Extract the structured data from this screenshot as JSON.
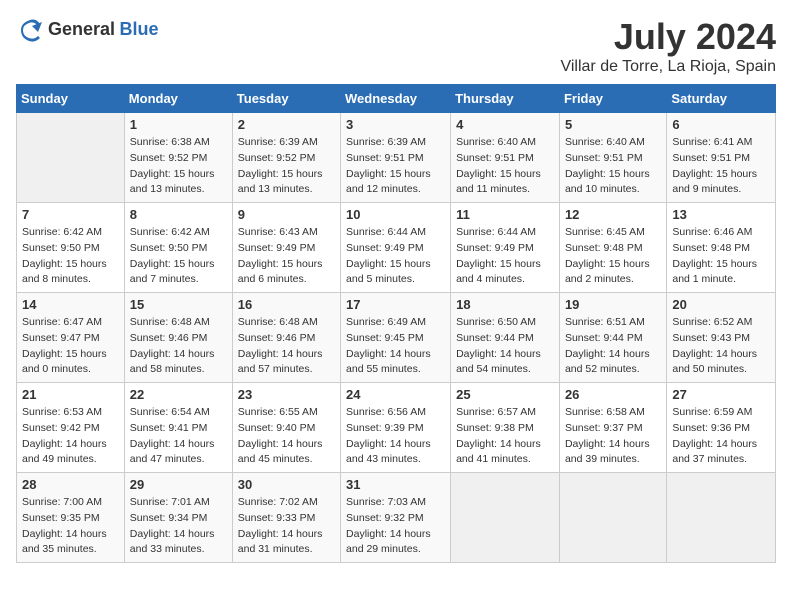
{
  "logo": {
    "general": "General",
    "blue": "Blue"
  },
  "title": "July 2024",
  "location": "Villar de Torre, La Rioja, Spain",
  "days_of_week": [
    "Sunday",
    "Monday",
    "Tuesday",
    "Wednesday",
    "Thursday",
    "Friday",
    "Saturday"
  ],
  "weeks": [
    [
      {
        "day": "",
        "content": ""
      },
      {
        "day": "1",
        "content": "Sunrise: 6:38 AM\nSunset: 9:52 PM\nDaylight: 15 hours\nand 13 minutes."
      },
      {
        "day": "2",
        "content": "Sunrise: 6:39 AM\nSunset: 9:52 PM\nDaylight: 15 hours\nand 13 minutes."
      },
      {
        "day": "3",
        "content": "Sunrise: 6:39 AM\nSunset: 9:51 PM\nDaylight: 15 hours\nand 12 minutes."
      },
      {
        "day": "4",
        "content": "Sunrise: 6:40 AM\nSunset: 9:51 PM\nDaylight: 15 hours\nand 11 minutes."
      },
      {
        "day": "5",
        "content": "Sunrise: 6:40 AM\nSunset: 9:51 PM\nDaylight: 15 hours\nand 10 minutes."
      },
      {
        "day": "6",
        "content": "Sunrise: 6:41 AM\nSunset: 9:51 PM\nDaylight: 15 hours\nand 9 minutes."
      }
    ],
    [
      {
        "day": "7",
        "content": "Sunrise: 6:42 AM\nSunset: 9:50 PM\nDaylight: 15 hours\nand 8 minutes."
      },
      {
        "day": "8",
        "content": "Sunrise: 6:42 AM\nSunset: 9:50 PM\nDaylight: 15 hours\nand 7 minutes."
      },
      {
        "day": "9",
        "content": "Sunrise: 6:43 AM\nSunset: 9:49 PM\nDaylight: 15 hours\nand 6 minutes."
      },
      {
        "day": "10",
        "content": "Sunrise: 6:44 AM\nSunset: 9:49 PM\nDaylight: 15 hours\nand 5 minutes."
      },
      {
        "day": "11",
        "content": "Sunrise: 6:44 AM\nSunset: 9:49 PM\nDaylight: 15 hours\nand 4 minutes."
      },
      {
        "day": "12",
        "content": "Sunrise: 6:45 AM\nSunset: 9:48 PM\nDaylight: 15 hours\nand 2 minutes."
      },
      {
        "day": "13",
        "content": "Sunrise: 6:46 AM\nSunset: 9:48 PM\nDaylight: 15 hours\nand 1 minute."
      }
    ],
    [
      {
        "day": "14",
        "content": "Sunrise: 6:47 AM\nSunset: 9:47 PM\nDaylight: 15 hours\nand 0 minutes."
      },
      {
        "day": "15",
        "content": "Sunrise: 6:48 AM\nSunset: 9:46 PM\nDaylight: 14 hours\nand 58 minutes."
      },
      {
        "day": "16",
        "content": "Sunrise: 6:48 AM\nSunset: 9:46 PM\nDaylight: 14 hours\nand 57 minutes."
      },
      {
        "day": "17",
        "content": "Sunrise: 6:49 AM\nSunset: 9:45 PM\nDaylight: 14 hours\nand 55 minutes."
      },
      {
        "day": "18",
        "content": "Sunrise: 6:50 AM\nSunset: 9:44 PM\nDaylight: 14 hours\nand 54 minutes."
      },
      {
        "day": "19",
        "content": "Sunrise: 6:51 AM\nSunset: 9:44 PM\nDaylight: 14 hours\nand 52 minutes."
      },
      {
        "day": "20",
        "content": "Sunrise: 6:52 AM\nSunset: 9:43 PM\nDaylight: 14 hours\nand 50 minutes."
      }
    ],
    [
      {
        "day": "21",
        "content": "Sunrise: 6:53 AM\nSunset: 9:42 PM\nDaylight: 14 hours\nand 49 minutes."
      },
      {
        "day": "22",
        "content": "Sunrise: 6:54 AM\nSunset: 9:41 PM\nDaylight: 14 hours\nand 47 minutes."
      },
      {
        "day": "23",
        "content": "Sunrise: 6:55 AM\nSunset: 9:40 PM\nDaylight: 14 hours\nand 45 minutes."
      },
      {
        "day": "24",
        "content": "Sunrise: 6:56 AM\nSunset: 9:39 PM\nDaylight: 14 hours\nand 43 minutes."
      },
      {
        "day": "25",
        "content": "Sunrise: 6:57 AM\nSunset: 9:38 PM\nDaylight: 14 hours\nand 41 minutes."
      },
      {
        "day": "26",
        "content": "Sunrise: 6:58 AM\nSunset: 9:37 PM\nDaylight: 14 hours\nand 39 minutes."
      },
      {
        "day": "27",
        "content": "Sunrise: 6:59 AM\nSunset: 9:36 PM\nDaylight: 14 hours\nand 37 minutes."
      }
    ],
    [
      {
        "day": "28",
        "content": "Sunrise: 7:00 AM\nSunset: 9:35 PM\nDaylight: 14 hours\nand 35 minutes."
      },
      {
        "day": "29",
        "content": "Sunrise: 7:01 AM\nSunset: 9:34 PM\nDaylight: 14 hours\nand 33 minutes."
      },
      {
        "day": "30",
        "content": "Sunrise: 7:02 AM\nSunset: 9:33 PM\nDaylight: 14 hours\nand 31 minutes."
      },
      {
        "day": "31",
        "content": "Sunrise: 7:03 AM\nSunset: 9:32 PM\nDaylight: 14 hours\nand 29 minutes."
      },
      {
        "day": "",
        "content": ""
      },
      {
        "day": "",
        "content": ""
      },
      {
        "day": "",
        "content": ""
      }
    ]
  ]
}
